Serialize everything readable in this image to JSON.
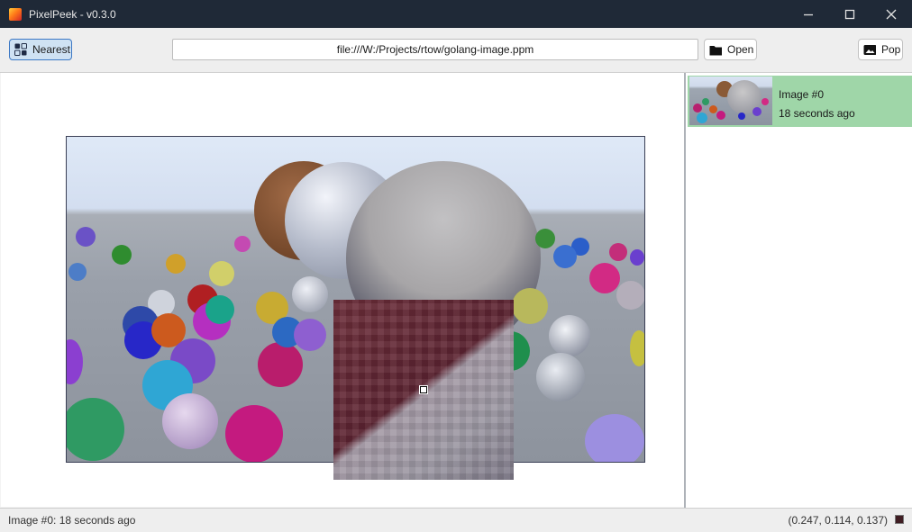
{
  "window": {
    "title": "PixelPeek - v0.3.0"
  },
  "toolbar": {
    "nearest_label": "Nearest",
    "url_value": "file:///W:/Projects/rtow/golang-image.ppm",
    "open_label": "Open",
    "pop_label": "Pop"
  },
  "history": {
    "items": [
      {
        "name": "Image #0",
        "time": "18 seconds ago"
      }
    ]
  },
  "status": {
    "image_name": "Image #0:",
    "image_time": "18 seconds ago",
    "pixel_value": "(0.247, 0.114, 0.137)"
  },
  "colors": {
    "selected_item": "#9fd6a8",
    "nearest_active": "#cfe2f3",
    "pixel_swatch": "#3f1d23",
    "titlebar": "#1f2937"
  },
  "icons": {
    "nearest": "grid-squares-icon",
    "open": "folder-icon",
    "pop": "image-icon",
    "minimize": "minimize-icon",
    "maximize": "maximize-icon",
    "close": "close-icon"
  }
}
